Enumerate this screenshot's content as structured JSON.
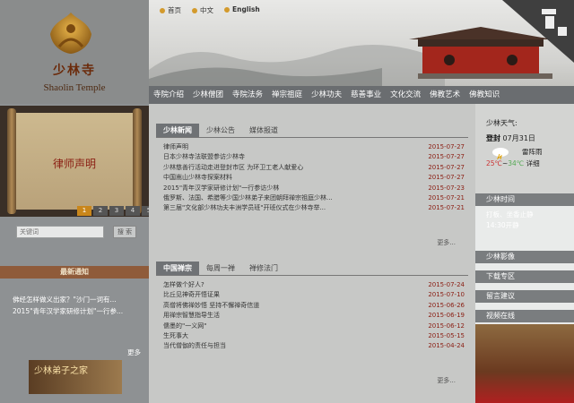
{
  "logo": {
    "name_cn": "少林寺",
    "name_en": "Shaolin Temple"
  },
  "header": {
    "lang": [
      "首页",
      "中文",
      "English"
    ],
    "nav": [
      "寺院介绍",
      "少林僧团",
      "寺院法务",
      "禅宗祖庭",
      "少林功夫",
      "慈善事业",
      "文化交流",
      "佛教艺术",
      "佛教知识"
    ]
  },
  "slider": {
    "title": "律师声明",
    "pages": [
      "1",
      "2",
      "3",
      "4",
      "5"
    ],
    "active": "1"
  },
  "search": {
    "placeholder": "关键词",
    "button": "搜 索"
  },
  "notice": {
    "heading": "最新通知",
    "items": [
      "佛经怎样做义出家？\"沙门一词有...",
      "2015\"青年汉学家研修计划\"一行参..."
    ],
    "more": "更多"
  },
  "banner": {
    "text": "少林弟子之家"
  },
  "news": {
    "tabs": [
      "少林新闻",
      "少林公告",
      "媒体报道"
    ],
    "items": [
      {
        "title": "律师声明",
        "date": "2015-07-27"
      },
      {
        "title": "日本少林寺法联盟参访少林寺",
        "date": "2015-07-27"
      },
      {
        "title": "少林慈善行活动走进登封市区 为环卫工老人献爱心",
        "date": "2015-07-27"
      },
      {
        "title": "中国嵩山少林寺探案材料",
        "date": "2015-07-27"
      },
      {
        "title": "2015\"青年汉学家研修计划\"一行参访少林",
        "date": "2015-07-23"
      },
      {
        "title": "俄罗斯、法国、希腊等少国少林弟子来团朝拜禅宗祖庭少林...",
        "date": "2015-07-21"
      },
      {
        "title": "第三届\"文化部少林功夫丰洲学员班\"开班仪式在少林寺举...",
        "date": "2015-07-21"
      }
    ],
    "more": "更多..."
  },
  "chan": {
    "tabs": [
      "中国禅宗",
      "每周一禅",
      "禅修法门"
    ],
    "items": [
      {
        "title": "怎样做个好人?",
        "date": "2015-07-24"
      },
      {
        "title": "比丘见神奇开悟证果",
        "date": "2015-07-10"
      },
      {
        "title": "高僧将佛禅妙悟 坚持不懈禅奇信道",
        "date": "2015-06-26"
      },
      {
        "title": "用禅宗智慧指导生活",
        "date": "2015-06-19"
      },
      {
        "title": "儒墨的\"一义网\"",
        "date": "2015-06-12"
      },
      {
        "title": "生死事大",
        "date": "2015-05-15"
      },
      {
        "title": "当代僧伽的责任与担当",
        "date": "2015-04-24"
      }
    ],
    "more": "更多..."
  },
  "right": {
    "weather_heading": "少林天气:",
    "location": "登封",
    "date": "07月31日",
    "condition": "雷阵雨",
    "temp_low": "25℃",
    "temp_high": "34℃",
    "detail": "详细",
    "schedule_heading": "少林时间",
    "schedule": [
      "打板、坐香止静",
      "14:30开静"
    ],
    "links": [
      "少林影像",
      "下载专区",
      "留言建议",
      "视频在线"
    ]
  },
  "colors": {
    "accent": "#8a1d12",
    "nav": "#6a6d70",
    "notice_bar": "#8f5b3a"
  }
}
